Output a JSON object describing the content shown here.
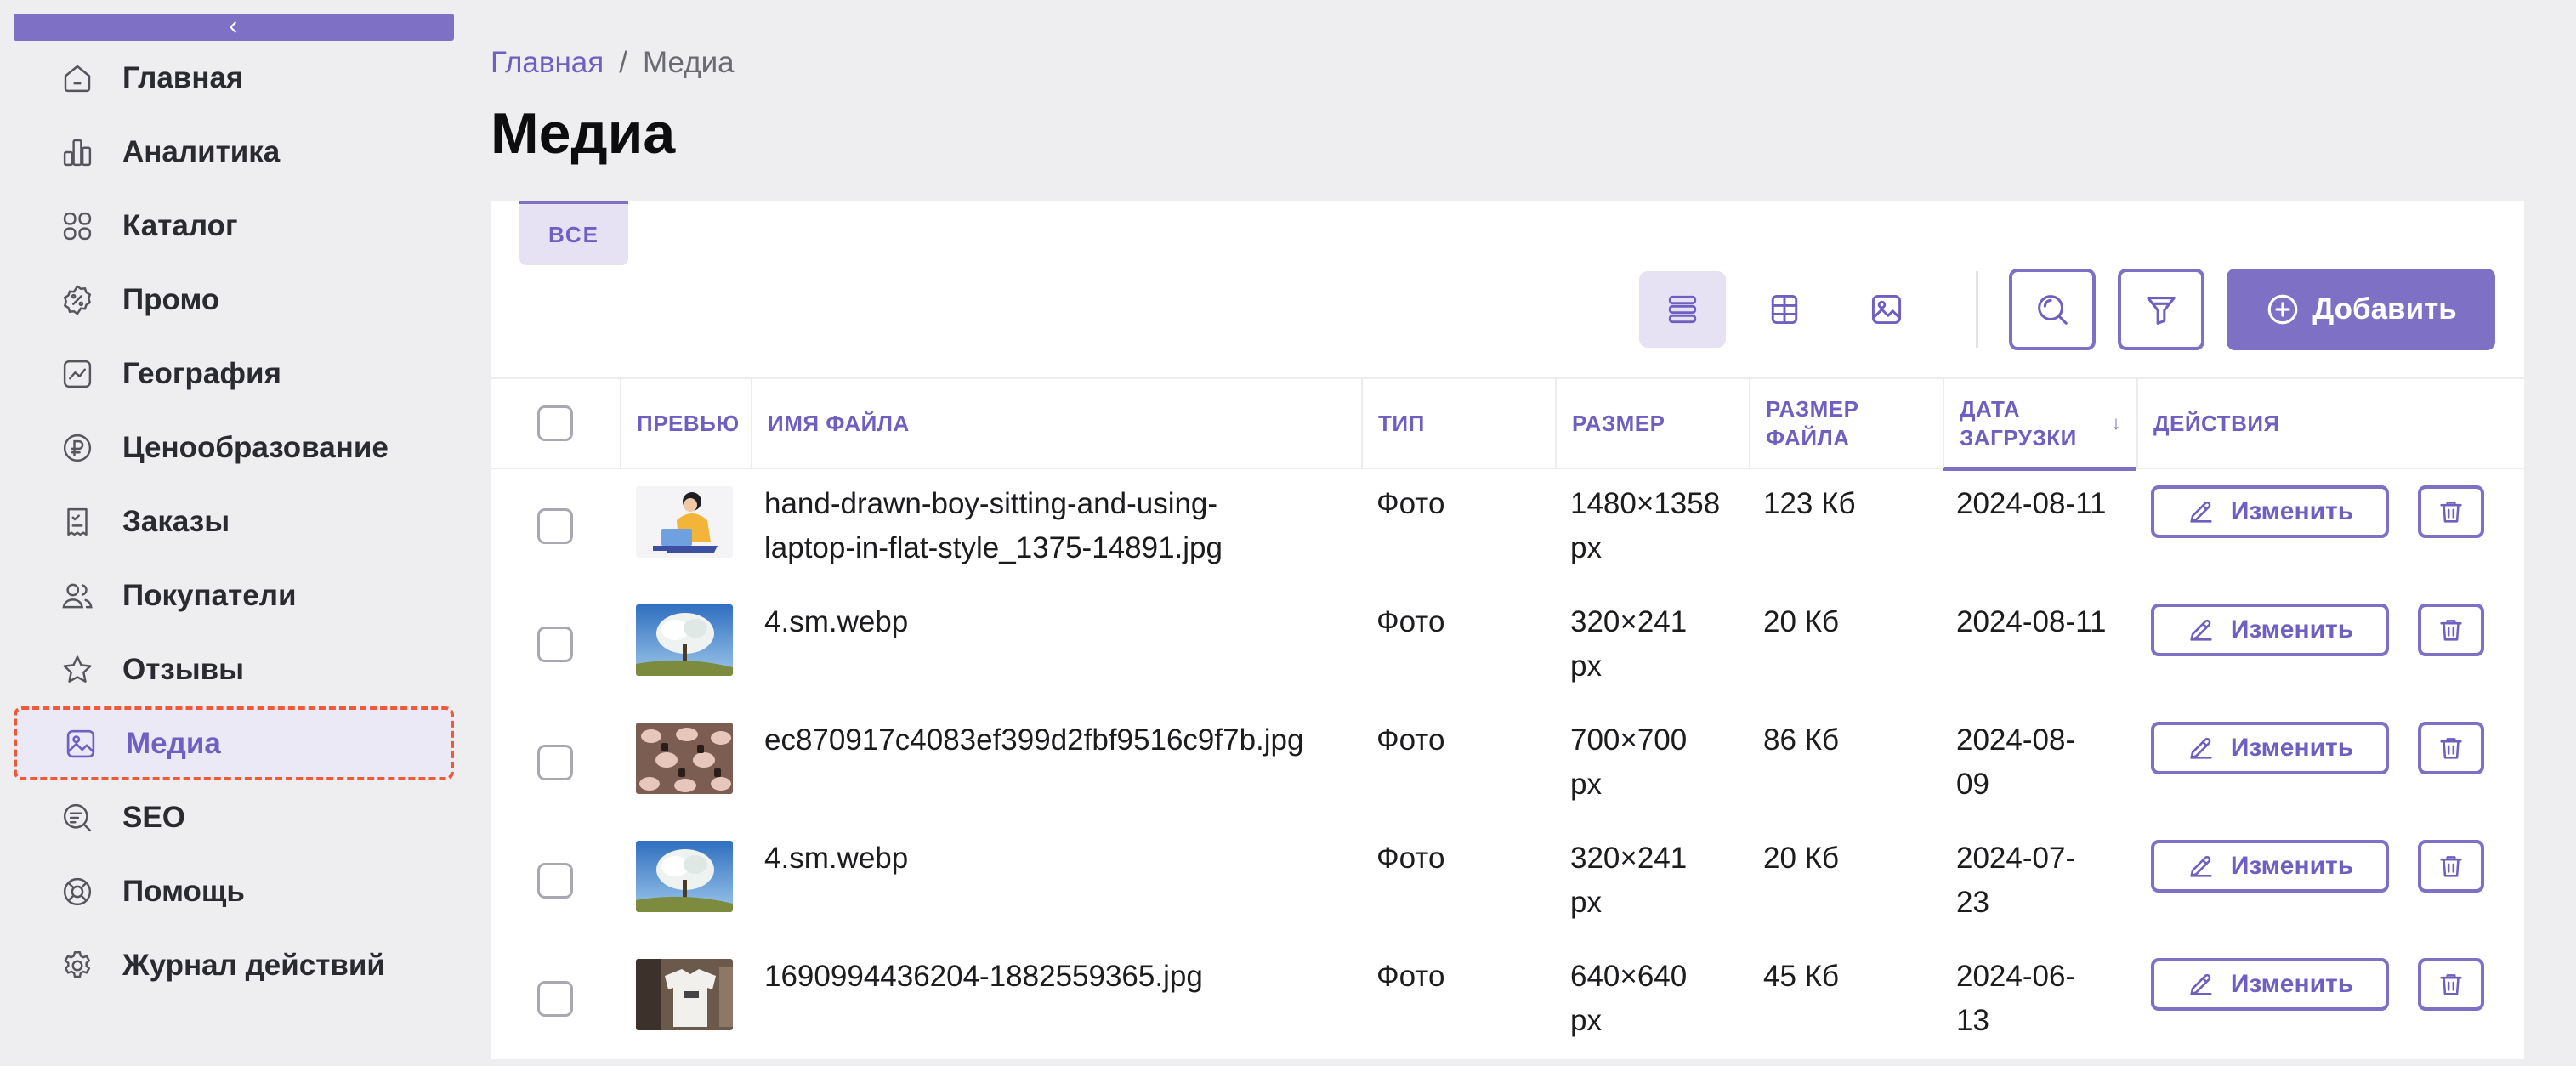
{
  "sidebar": {
    "collapse_icon": "chevron-left-icon",
    "items": [
      {
        "label": "Главная",
        "icon": "home-icon"
      },
      {
        "label": "Аналитика",
        "icon": "bar-chart-icon"
      },
      {
        "label": "Каталог",
        "icon": "grid-icon"
      },
      {
        "label": "Промо",
        "icon": "percent-badge-icon"
      },
      {
        "label": "География",
        "icon": "trend-chart-icon"
      },
      {
        "label": "Ценообразование",
        "icon": "ruble-icon"
      },
      {
        "label": "Заказы",
        "icon": "clipboard-icon"
      },
      {
        "label": "Покупатели",
        "icon": "users-icon"
      },
      {
        "label": "Отзывы",
        "icon": "star-icon"
      },
      {
        "label": "Медиа",
        "icon": "image-icon",
        "active": true
      },
      {
        "label": "SEO",
        "icon": "search-list-icon"
      },
      {
        "label": "Помощь",
        "icon": "lifebuoy-icon"
      },
      {
        "label": "Журнал действий",
        "icon": "gear-icon"
      }
    ]
  },
  "breadcrumb": {
    "home": "Главная",
    "separator": "/",
    "current": "Медиа"
  },
  "page_title": "Медиа",
  "tabs": {
    "all": "ВСЕ"
  },
  "toolbar": {
    "add_label": "Добавить"
  },
  "table": {
    "headers": {
      "preview": "ПРЕВЬЮ",
      "filename": "ИМЯ ФАЙЛА",
      "type": "ТИП",
      "size": "РАЗМЕР",
      "filesize_1": "РАЗМЕР",
      "filesize_2": "ФАЙЛА",
      "date_1": "ДАТА",
      "date_2": "ЗАГРУЗКИ",
      "actions": "ДЕЙСТВИЯ"
    },
    "sort_arrow": "↓",
    "edit_label": "Изменить",
    "rows": [
      {
        "name1": "hand-drawn-boy-sitting-and-using-",
        "name2": "laptop-in-flat-style_1375-14891.jpg",
        "type": "Фото",
        "size1": "1480×1358",
        "size2": "px",
        "filesize": "123 Кб",
        "date1": "2024-08-11",
        "date2": ""
      },
      {
        "name1": "4.sm.webp",
        "name2": "",
        "type": "Фото",
        "size1": "320×241",
        "size2": "px",
        "filesize": "20 Кб",
        "date1": "2024-08-11",
        "date2": ""
      },
      {
        "name1": "ec870917c4083ef399d2fbf9516c9f7b.jpg",
        "name2": "",
        "type": "Фото",
        "size1": "700×700",
        "size2": "px",
        "filesize": "86 Кб",
        "date1": "2024-08-",
        "date2": "09"
      },
      {
        "name1": "4.sm.webp",
        "name2": "",
        "type": "Фото",
        "size1": "320×241",
        "size2": "px",
        "filesize": "20 Кб",
        "date1": "2024-07-",
        "date2": "23"
      },
      {
        "name1": "1690994436204-1882559365.jpg",
        "name2": "",
        "type": "Фото",
        "size1": "640×640",
        "size2": "px",
        "filesize": "45 Кб",
        "date1": "2024-06-",
        "date2": "13"
      }
    ]
  },
  "colors": {
    "accent": "#7d70c5",
    "accent_text": "#6e5fc0",
    "highlight_border": "#ef5a36",
    "background": "#eeeef1"
  }
}
